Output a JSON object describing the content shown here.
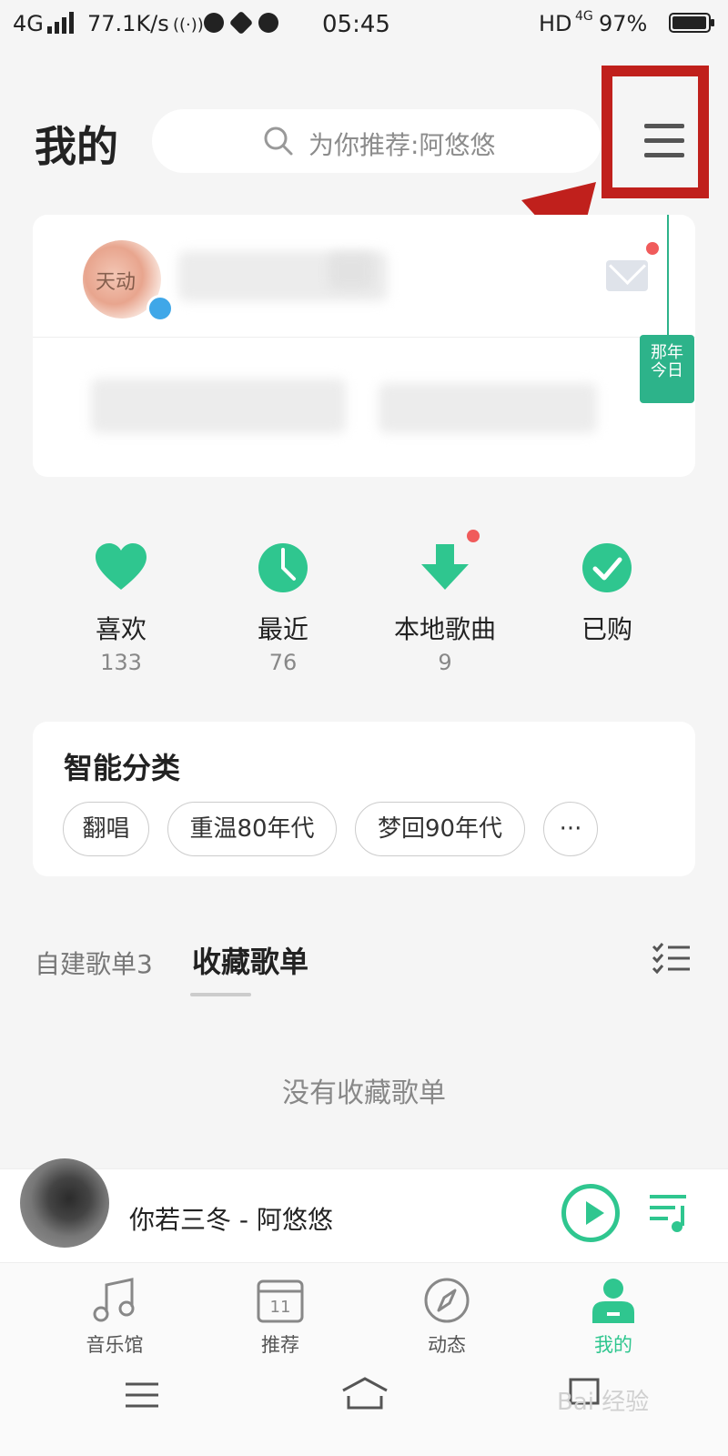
{
  "status_bar": {
    "network": "4G",
    "speed": "77.1K/s",
    "time": "05:45",
    "hd": "HD",
    "network_right": "4G",
    "battery_text": "97%",
    "battery_level": 0.97
  },
  "header": {
    "title": "我的",
    "search_placeholder": "为你推荐:阿悠悠"
  },
  "profile": {
    "avatar_text": "天动",
    "has_unread_mail": true
  },
  "calendar_tag": {
    "line1": "那年",
    "line2": "今日"
  },
  "quick_items": [
    {
      "label": "喜欢",
      "count": "133",
      "icon": "heart-icon"
    },
    {
      "label": "最近",
      "count": "76",
      "icon": "clock-icon"
    },
    {
      "label": "本地歌曲",
      "count": "9",
      "icon": "download-icon"
    },
    {
      "label": "已购",
      "count": "",
      "icon": "check-circle-icon"
    }
  ],
  "smart_category": {
    "title": "智能分类",
    "chips": [
      "翻唱",
      "重温80年代",
      "梦回90年代"
    ],
    "more": "···"
  },
  "playlist_tabs": {
    "own": "自建歌单3",
    "fav": "收藏歌单",
    "empty": "没有收藏歌单"
  },
  "player": {
    "song": "你若三冬 - 阿悠悠"
  },
  "bottom_nav": [
    {
      "label": "音乐馆",
      "icon": "music-note-icon",
      "active": false
    },
    {
      "label": "推荐",
      "icon": "calendar-icon",
      "active": false,
      "day": "11"
    },
    {
      "label": "动态",
      "icon": "compass-icon",
      "active": false
    },
    {
      "label": "我的",
      "icon": "person-icon",
      "active": true
    }
  ],
  "colors": {
    "accent": "#2fc68f",
    "annotation": "#c0201c",
    "badge": "#f05b5b"
  },
  "watermark": "Bai 经验"
}
